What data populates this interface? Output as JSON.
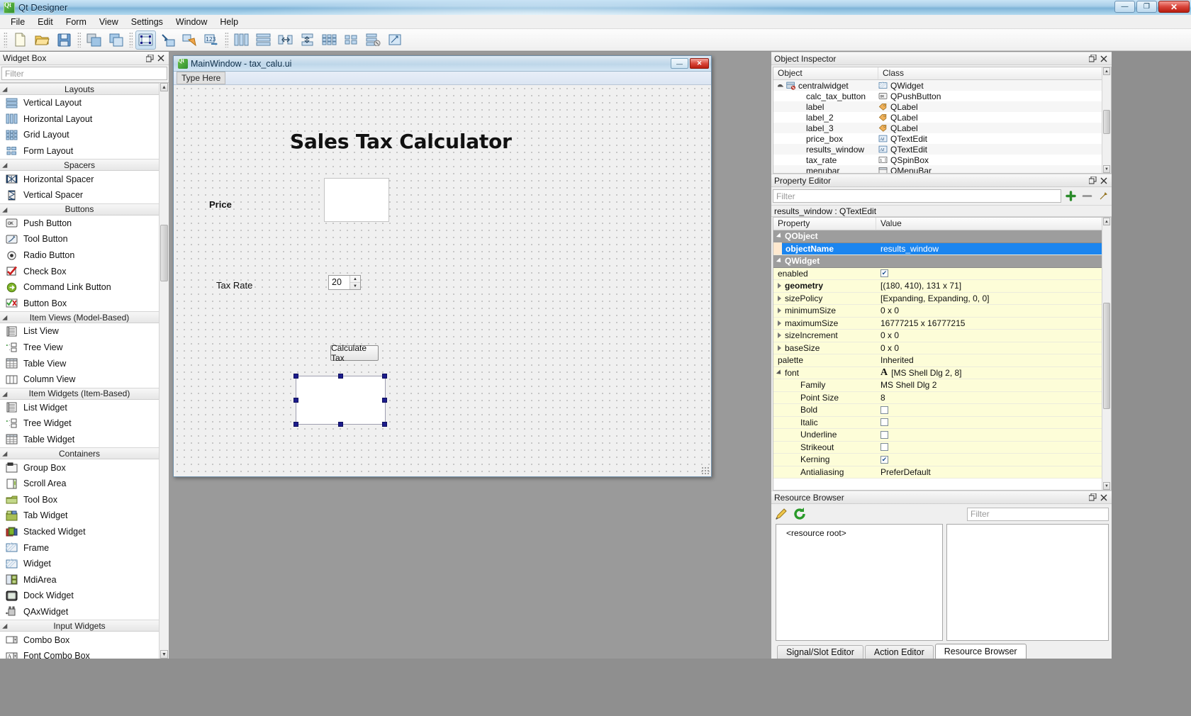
{
  "titlebar": {
    "title": "Qt Designer",
    "icon": "qt-logo-icon",
    "minimize": "—",
    "maximize": "❐",
    "close": "✕"
  },
  "menubar": {
    "items": [
      "File",
      "Edit",
      "Form",
      "View",
      "Settings",
      "Window",
      "Help"
    ]
  },
  "toolbar": {
    "groups": [
      [
        "new-form-icon",
        "open-form-icon",
        "save-form-icon"
      ],
      [
        "copy-icon",
        "paste-icon"
      ],
      [
        "edit-widgets-icon",
        "edit-signals-slots-icon",
        "edit-buddies-icon",
        "edit-tab-order-icon"
      ],
      [
        "layout-horizontally-icon",
        "layout-vertically-icon",
        "layout-splitter-horizontal-icon",
        "layout-splitter-vertical-icon",
        "layout-grid-icon",
        "layout-form-icon",
        "break-layout-icon",
        "adjust-size-icon"
      ]
    ]
  },
  "widget_box": {
    "title": "Widget Box",
    "filter_placeholder": "Filter",
    "categories": [
      {
        "name": "Layouts",
        "items": [
          {
            "label": "Vertical Layout",
            "icon": "vertical-layout-icon"
          },
          {
            "label": "Horizontal Layout",
            "icon": "horizontal-layout-icon"
          },
          {
            "label": "Grid Layout",
            "icon": "grid-layout-icon"
          },
          {
            "label": "Form Layout",
            "icon": "form-layout-icon"
          }
        ]
      },
      {
        "name": "Spacers",
        "items": [
          {
            "label": "Horizontal Spacer",
            "icon": "horizontal-spacer-icon"
          },
          {
            "label": "Vertical Spacer",
            "icon": "vertical-spacer-icon"
          }
        ]
      },
      {
        "name": "Buttons",
        "items": [
          {
            "label": "Push Button",
            "icon": "push-button-icon"
          },
          {
            "label": "Tool Button",
            "icon": "tool-button-icon"
          },
          {
            "label": "Radio Button",
            "icon": "radio-button-icon"
          },
          {
            "label": "Check Box",
            "icon": "check-box-icon"
          },
          {
            "label": "Command Link Button",
            "icon": "command-link-button-icon"
          },
          {
            "label": "Button Box",
            "icon": "button-box-icon"
          }
        ]
      },
      {
        "name": "Item Views (Model-Based)",
        "items": [
          {
            "label": "List View",
            "icon": "list-view-icon"
          },
          {
            "label": "Tree View",
            "icon": "tree-view-icon"
          },
          {
            "label": "Table View",
            "icon": "table-view-icon"
          },
          {
            "label": "Column View",
            "icon": "column-view-icon"
          }
        ]
      },
      {
        "name": "Item Widgets (Item-Based)",
        "items": [
          {
            "label": "List Widget",
            "icon": "list-widget-icon"
          },
          {
            "label": "Tree Widget",
            "icon": "tree-widget-icon"
          },
          {
            "label": "Table Widget",
            "icon": "table-widget-icon"
          }
        ]
      },
      {
        "name": "Containers",
        "items": [
          {
            "label": "Group Box",
            "icon": "group-box-icon"
          },
          {
            "label": "Scroll Area",
            "icon": "scroll-area-icon"
          },
          {
            "label": "Tool Box",
            "icon": "tool-box-icon"
          },
          {
            "label": "Tab Widget",
            "icon": "tab-widget-icon"
          },
          {
            "label": "Stacked Widget",
            "icon": "stacked-widget-icon"
          },
          {
            "label": "Frame",
            "icon": "frame-icon"
          },
          {
            "label": "Widget",
            "icon": "widget-icon"
          },
          {
            "label": "MdiArea",
            "icon": "mdi-area-icon"
          },
          {
            "label": "Dock Widget",
            "icon": "dock-widget-icon"
          },
          {
            "label": "QAxWidget",
            "icon": "qax-widget-icon"
          }
        ]
      },
      {
        "name": "Input Widgets",
        "items": [
          {
            "label": "Combo Box",
            "icon": "combo-box-icon"
          },
          {
            "label": "Font Combo Box",
            "icon": "font-combo-box-icon"
          }
        ]
      }
    ]
  },
  "form_window": {
    "title": "MainWindow - tax_calu.ui",
    "icon": "qt-logo-icon",
    "minimize": "—",
    "close": "✕",
    "menu_placeholder": "Type Here",
    "canvas": {
      "heading": "Sales Tax Calculator",
      "price_label": "Price",
      "tax_rate_label": "Tax Rate",
      "tax_rate_value": "20",
      "calculate_button": "Calculate Tax",
      "price_box_value": "",
      "results_window_value": ""
    }
  },
  "object_inspector": {
    "title": "Object Inspector",
    "columns": [
      "Object",
      "Class"
    ],
    "rows": [
      {
        "object": "centralwidget",
        "class": "QWidget",
        "icon": "widget-icon",
        "indent": 1,
        "expanded": true
      },
      {
        "object": "calc_tax_button",
        "class": "QPushButton",
        "icon": "push-button-icon",
        "indent": 2
      },
      {
        "object": "label",
        "class": "QLabel",
        "icon": "label-icon",
        "indent": 2
      },
      {
        "object": "label_2",
        "class": "QLabel",
        "icon": "label-icon",
        "indent": 2
      },
      {
        "object": "label_3",
        "class": "QLabel",
        "icon": "label-icon",
        "indent": 2
      },
      {
        "object": "price_box",
        "class": "QTextEdit",
        "icon": "text-edit-icon",
        "indent": 2
      },
      {
        "object": "results_window",
        "class": "QTextEdit",
        "icon": "text-edit-icon",
        "indent": 2
      },
      {
        "object": "tax_rate",
        "class": "QSpinBox",
        "icon": "spin-box-icon",
        "indent": 2
      },
      {
        "object": "menubar",
        "class": "QMenuBar",
        "icon": "menu-bar-icon",
        "indent": 2
      }
    ]
  },
  "property_editor": {
    "title": "Property Editor",
    "filter_placeholder": "Filter",
    "object_line": "results_window : QTextEdit",
    "columns": [
      "Property",
      "Value"
    ],
    "rows": [
      {
        "name": "QObject",
        "value": "",
        "kind": "group",
        "expanded": true
      },
      {
        "name": "objectName",
        "value": "results_window",
        "kind": "selected"
      },
      {
        "name": "QWidget",
        "value": "",
        "kind": "group",
        "expanded": true
      },
      {
        "name": "enabled",
        "value": "",
        "kind": "check",
        "checked": true
      },
      {
        "name": "geometry",
        "value": "[(180, 410), 131 x 71]",
        "kind": "expandable",
        "bold": true
      },
      {
        "name": "sizePolicy",
        "value": "[Expanding, Expanding, 0, 0]",
        "kind": "expandable"
      },
      {
        "name": "minimumSize",
        "value": "0 x 0",
        "kind": "expandable"
      },
      {
        "name": "maximumSize",
        "value": "16777215 x 16777215",
        "kind": "expandable"
      },
      {
        "name": "sizeIncrement",
        "value": "0 x 0",
        "kind": "expandable"
      },
      {
        "name": "baseSize",
        "value": "0 x 0",
        "kind": "expandable"
      },
      {
        "name": "palette",
        "value": "Inherited",
        "kind": "plain"
      },
      {
        "name": "font",
        "value": "[MS Shell Dlg 2, 8]",
        "kind": "font-open",
        "expanded": true
      },
      {
        "name": "Family",
        "value": "MS Shell Dlg 2",
        "kind": "sub"
      },
      {
        "name": "Point Size",
        "value": "8",
        "kind": "sub"
      },
      {
        "name": "Bold",
        "value": "",
        "kind": "sub-check",
        "checked": false
      },
      {
        "name": "Italic",
        "value": "",
        "kind": "sub-check",
        "checked": false
      },
      {
        "name": "Underline",
        "value": "",
        "kind": "sub-check",
        "checked": false
      },
      {
        "name": "Strikeout",
        "value": "",
        "kind": "sub-check",
        "checked": false
      },
      {
        "name": "Kerning",
        "value": "",
        "kind": "sub-check",
        "checked": true
      },
      {
        "name": "Antialiasing",
        "value": "PreferDefault",
        "kind": "sub"
      }
    ]
  },
  "resource_browser": {
    "title": "Resource Browser",
    "edit_icon": "pencil-edit-icon",
    "reload_icon": "reload-refresh-icon",
    "filter_placeholder": "Filter",
    "root_label": "<resource root>",
    "tabs": [
      {
        "label": "Signal/Slot Editor",
        "active": false
      },
      {
        "label": "Action Editor",
        "active": false
      },
      {
        "label": "Resource Browser",
        "active": true
      }
    ]
  },
  "colors": {
    "accent_selection": "#1b85ef",
    "property_group": "#9d9d9d",
    "property_yellow": "#fdfdd8",
    "handle_blue": "#1c1c8c",
    "mdi_background": "#9a9a9a"
  }
}
